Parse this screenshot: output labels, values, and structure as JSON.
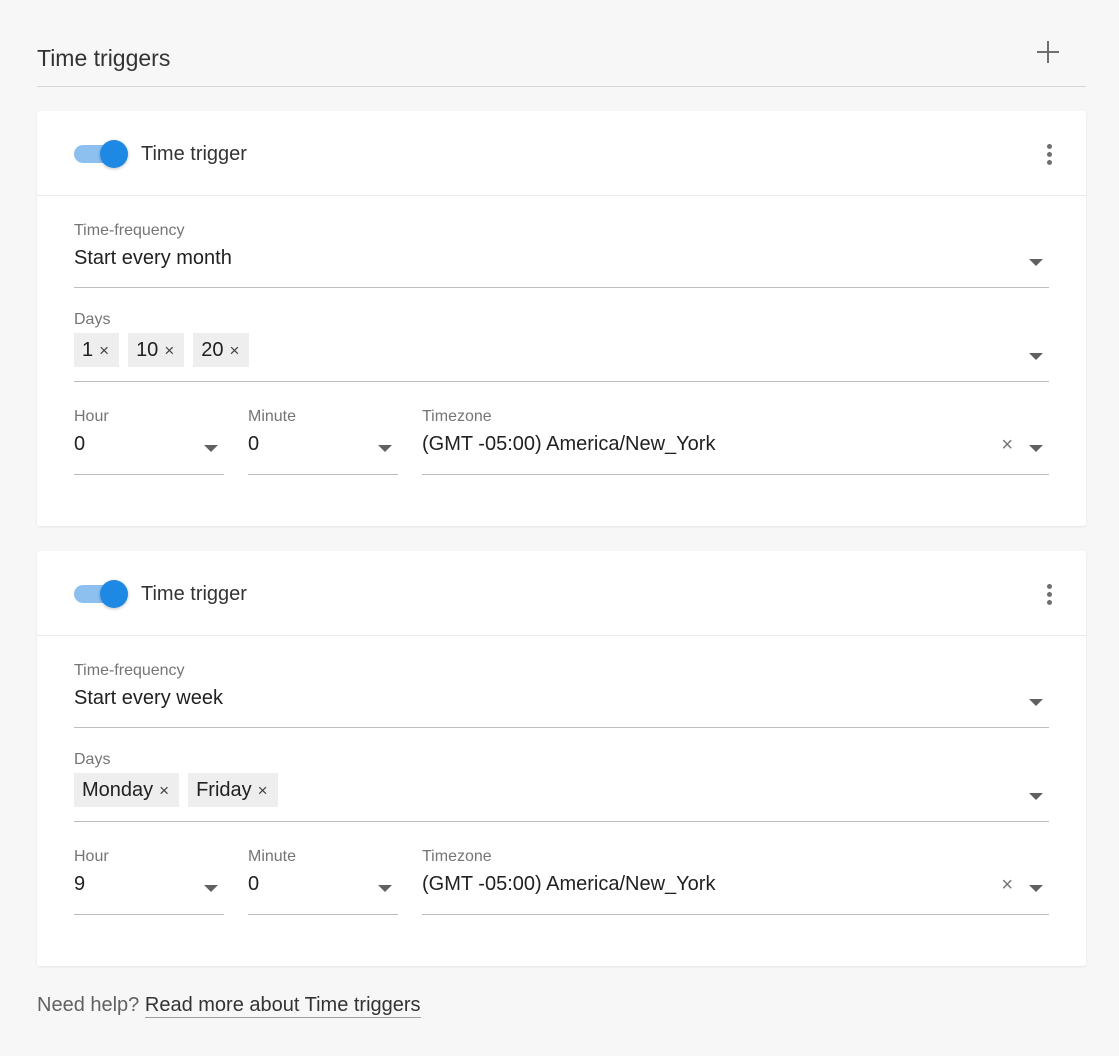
{
  "section": {
    "title": "Time triggers",
    "add_icon": "plus-icon"
  },
  "triggers": [
    {
      "title": "Time trigger",
      "enabled": true,
      "frequency": {
        "label": "Time-frequency",
        "value": "Start every month"
      },
      "days": {
        "label": "Days",
        "chips": [
          "1",
          "10",
          "20"
        ]
      },
      "hour": {
        "label": "Hour",
        "value": "0"
      },
      "minute": {
        "label": "Minute",
        "value": "0"
      },
      "timezone": {
        "label": "Timezone",
        "value": "(GMT -05:00) America/New_York"
      }
    },
    {
      "title": "Time trigger",
      "enabled": true,
      "frequency": {
        "label": "Time-frequency",
        "value": "Start every week"
      },
      "days": {
        "label": "Days",
        "chips": [
          "Monday",
          "Friday"
        ]
      },
      "hour": {
        "label": "Hour",
        "value": "9"
      },
      "minute": {
        "label": "Minute",
        "value": "0"
      },
      "timezone": {
        "label": "Timezone",
        "value": "(GMT -05:00) America/New_York"
      }
    }
  ],
  "chip_remove_glyph": "×",
  "clear_glyph": "×",
  "help": {
    "prefix": "Need help?",
    "link_text": "Read more about Time triggers"
  },
  "colors": {
    "accent": "#1e88e5",
    "toggle_track": "#8ec0ef"
  }
}
